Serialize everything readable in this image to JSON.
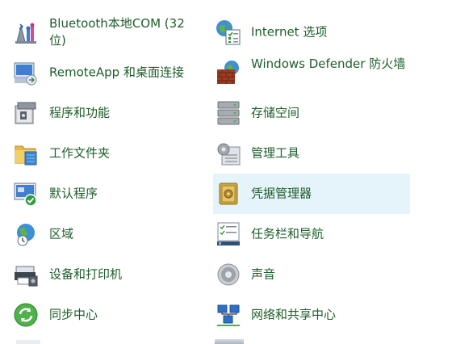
{
  "items": [
    {
      "id": "bluetooth",
      "label": "Bluetooth本地COM (32位)",
      "icon": "bluetooth-com-icon"
    },
    {
      "id": "internet",
      "label": "Internet 选项",
      "icon": "internet-options-icon"
    },
    {
      "id": "remoteapp",
      "label": "RemoteApp 和桌面连接",
      "icon": "remoteapp-icon"
    },
    {
      "id": "defender",
      "label": "Windows Defender 防火墙",
      "icon": "firewall-icon"
    },
    {
      "id": "programs",
      "label": "程序和功能",
      "icon": "programs-icon"
    },
    {
      "id": "storage",
      "label": "存储空间",
      "icon": "storage-spaces-icon"
    },
    {
      "id": "workfolders",
      "label": "工作文件夹",
      "icon": "work-folders-icon"
    },
    {
      "id": "admintools",
      "label": "管理工具",
      "icon": "admin-tools-icon"
    },
    {
      "id": "defaultprog",
      "label": "默认程序",
      "icon": "default-programs-icon"
    },
    {
      "id": "credmgr",
      "label": "凭据管理器",
      "icon": "credential-manager-icon"
    },
    {
      "id": "region",
      "label": "区域",
      "icon": "region-icon"
    },
    {
      "id": "taskbar",
      "label": "任务栏和导航",
      "icon": "taskbar-icon"
    },
    {
      "id": "devices",
      "label": "设备和打印机",
      "icon": "devices-printers-icon"
    },
    {
      "id": "sound",
      "label": "声音",
      "icon": "sound-icon"
    },
    {
      "id": "sync",
      "label": "同步中心",
      "icon": "sync-center-icon"
    },
    {
      "id": "network",
      "label": "网络和共享中心",
      "icon": "network-sharing-icon"
    }
  ],
  "colors": {
    "link_text": "#1e5e2a",
    "hover_bg": "#e5f3fb"
  }
}
